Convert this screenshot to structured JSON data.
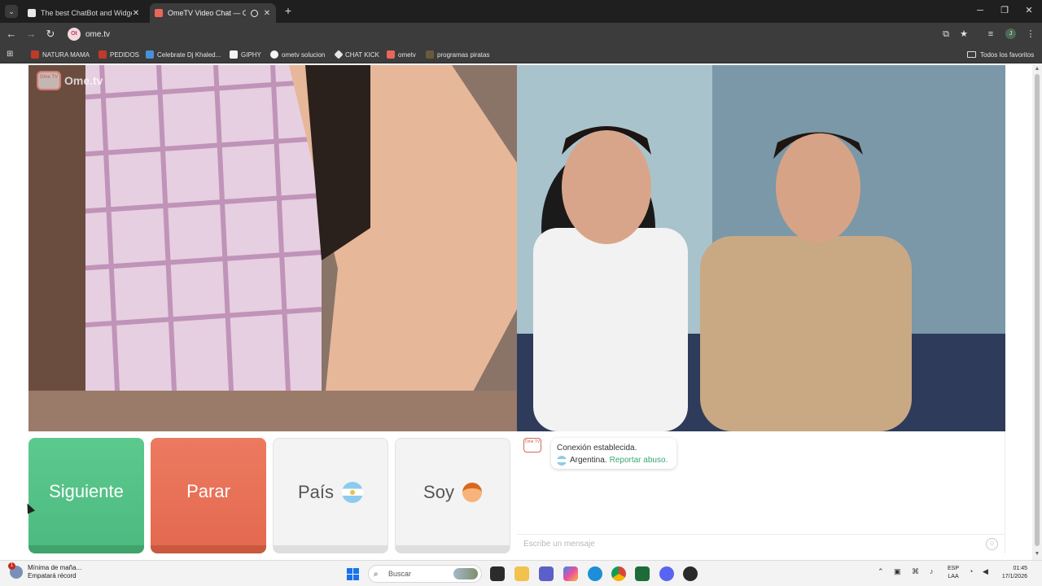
{
  "browser": {
    "tabs": [
      {
        "title": "The best ChatBot and Widgets",
        "active": false,
        "favicon_color": "#e8e8e8"
      },
      {
        "title": "OmeTV Video Chat — Ome",
        "active": true,
        "favicon_color": "#e8675a"
      }
    ],
    "url": "ome.tv",
    "site_chip": "Ot",
    "profile_initial": "J",
    "bookmarks": [
      {
        "label": "NATURA MAMA",
        "color": "#c0392b"
      },
      {
        "label": "PEDIDOS",
        "color": "#c0392b"
      },
      {
        "label": "Celebrate Dj Khaled...",
        "color": "#4a90d9"
      },
      {
        "label": "GIPHY",
        "color": "#f5f5f5"
      },
      {
        "label": "ometv solucion",
        "color": "#f5f5f5"
      },
      {
        "label": "CHAT KICK",
        "color": "#e6e6e6"
      },
      {
        "label": "ometv",
        "color": "#e8675a"
      },
      {
        "label": "programas piratas",
        "color": "#6b5a3a"
      }
    ],
    "all_bookmarks": "Todos los favoritos"
  },
  "site": {
    "logo_text": "Ome.tv",
    "logo_tv": "Ome TV"
  },
  "controls": {
    "next_label": "Siguiente",
    "stop_label": "Parar",
    "country_label": "País",
    "gender_label": "Soy",
    "next_color": "#4dbb80",
    "stop_color": "#e46a50"
  },
  "chat": {
    "system_icon": "Ome TV",
    "connection_msg": "Conexión establecida.",
    "country": "Argentina.",
    "report_link": "Reportar abuso.",
    "input_placeholder": "Escribe un mensaje"
  },
  "taskbar": {
    "weather_title": "Mínima de maña...",
    "weather_subtitle": "Empatará récord",
    "weather_badge": "1",
    "search_placeholder": "Buscar",
    "lang_line1": "ESP",
    "lang_line2": "LAA",
    "time": "01:45",
    "date": "17/1/2026"
  }
}
